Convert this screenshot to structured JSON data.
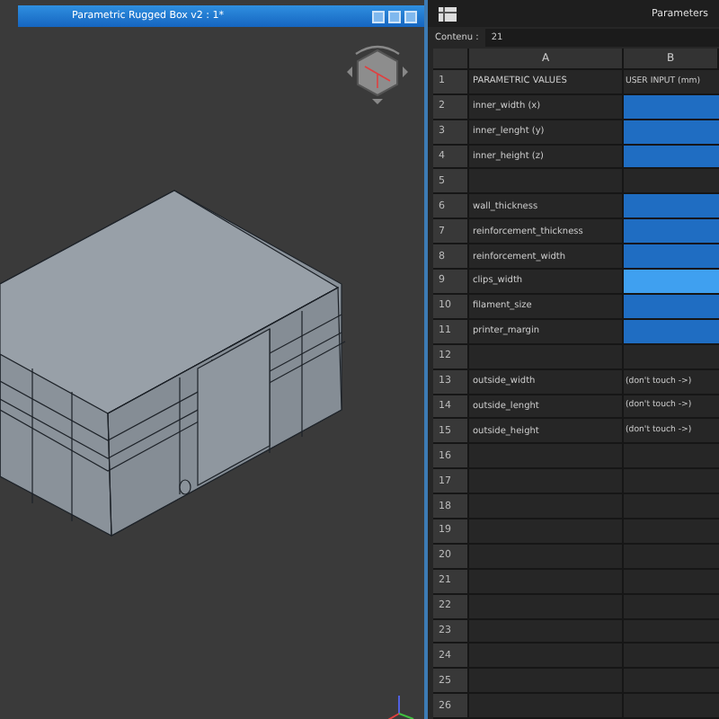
{
  "viewport": {
    "title": "Parametric Rugged Box v2 : 1*"
  },
  "spreadsheet": {
    "title": "Parameters",
    "contents_label": "Contenu :",
    "contents_value": "21",
    "columns": [
      "A",
      "B"
    ],
    "rows": [
      {
        "number": "1",
        "a": "PARAMETRIC VALUES",
        "b": "USER INPUT (mm)",
        "kind": "text",
        "selected": false
      },
      {
        "number": "2",
        "a": "inner_width (x)",
        "kind": "input",
        "selected": false
      },
      {
        "number": "3",
        "a": "inner_lenght (y)",
        "kind": "input",
        "selected": false
      },
      {
        "number": "4",
        "a": "inner_height (z)",
        "kind": "input",
        "selected": false
      },
      {
        "number": "5",
        "kind": "none",
        "selected": false
      },
      {
        "number": "6",
        "a": "wall_thickness",
        "kind": "input",
        "selected": false
      },
      {
        "number": "7",
        "a": "reinforcement_thickness",
        "kind": "input",
        "selected": false
      },
      {
        "number": "8",
        "a": "reinforcement_width",
        "kind": "input",
        "selected": false
      },
      {
        "number": "9",
        "a": "clips_width",
        "kind": "input",
        "selected": true
      },
      {
        "number": "10",
        "a": "filament_size",
        "kind": "input",
        "selected": false
      },
      {
        "number": "11",
        "a": "printer_margin",
        "kind": "input",
        "selected": false
      },
      {
        "number": "12",
        "kind": "none",
        "selected": false
      },
      {
        "number": "13",
        "a": "outside_width",
        "b": "(don't touch ->)",
        "kind": "text",
        "selected": false
      },
      {
        "number": "14",
        "a": "outside_lenght",
        "b": "(don't touch ->)",
        "kind": "text",
        "selected": false
      },
      {
        "number": "15",
        "a": "outside_height",
        "b": "(don't touch ->)",
        "kind": "text",
        "selected": false
      },
      {
        "number": "16",
        "kind": "none",
        "selected": false
      },
      {
        "number": "17",
        "kind": "none",
        "selected": false
      },
      {
        "number": "18",
        "kind": "none",
        "selected": false
      },
      {
        "number": "19",
        "kind": "none",
        "selected": false
      },
      {
        "number": "20",
        "kind": "none",
        "selected": false
      },
      {
        "number": "21",
        "kind": "none",
        "selected": false
      },
      {
        "number": "22",
        "kind": "none",
        "selected": false
      },
      {
        "number": "23",
        "kind": "none",
        "selected": false
      },
      {
        "number": "24",
        "kind": "none",
        "selected": false
      },
      {
        "number": "25",
        "kind": "none",
        "selected": false
      },
      {
        "number": "26",
        "kind": "none",
        "selected": false
      }
    ]
  }
}
